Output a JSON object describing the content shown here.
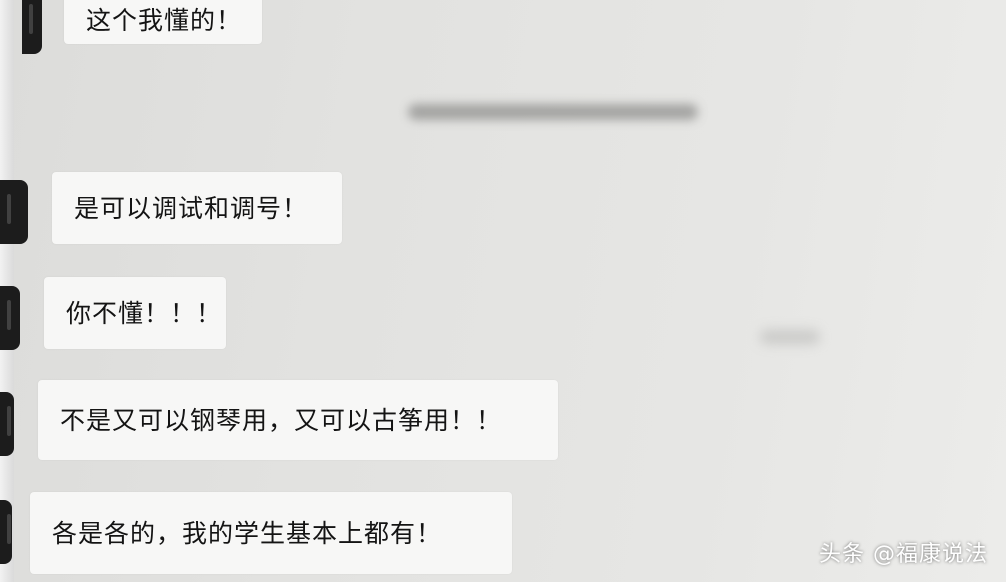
{
  "messages": [
    {
      "text": "这个我懂的！"
    },
    {
      "text": "是可以调试和调号！"
    },
    {
      "text": "你不懂！！！"
    },
    {
      "text": "不是又可以钢琴用，又可以古筝用！！"
    },
    {
      "text": "各是各的，我的学生基本上都有！"
    }
  ],
  "watermark": "头条 @福康说法"
}
